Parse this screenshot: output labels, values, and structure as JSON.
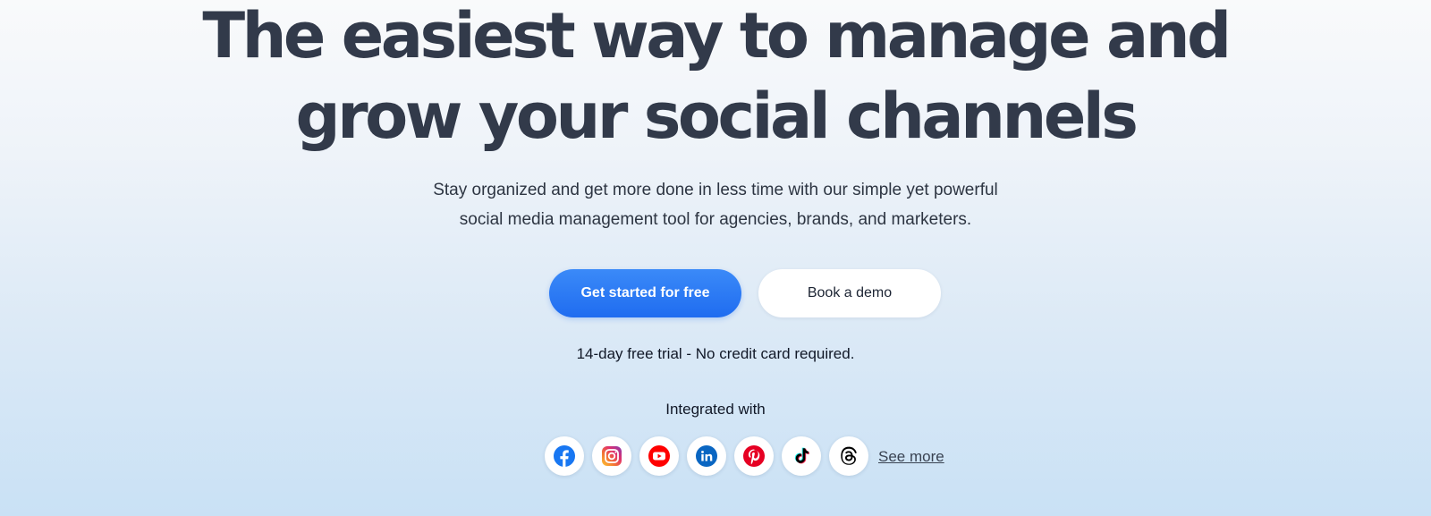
{
  "hero": {
    "headline_line1": "The easiest way to manage and",
    "headline_line2": "grow your social channels",
    "subtitle_line1": "Stay organized and get more done in less time with our simple yet powerful",
    "subtitle_line2": "social media management tool for agencies, brands, and marketers.",
    "primary_cta": "Get started for free",
    "secondary_cta": "Book a demo",
    "trial_note": "14-day free trial - No credit card required.",
    "integrated_label": "Integrated with",
    "see_more": "See more"
  },
  "integrations": [
    {
      "icon": "facebook-icon",
      "color": "#1877f2"
    },
    {
      "icon": "instagram-icon",
      "color": "#e1306c"
    },
    {
      "icon": "youtube-icon",
      "color": "#ff0000"
    },
    {
      "icon": "linkedin-icon",
      "color": "#0a66c2"
    },
    {
      "icon": "pinterest-icon",
      "color": "#e60023"
    },
    {
      "icon": "tiktok-icon",
      "color": "#000000"
    },
    {
      "icon": "threads-icon",
      "color": "#000000"
    }
  ],
  "colors": {
    "accent": "#2f7cf6",
    "heading": "#323a4a"
  }
}
